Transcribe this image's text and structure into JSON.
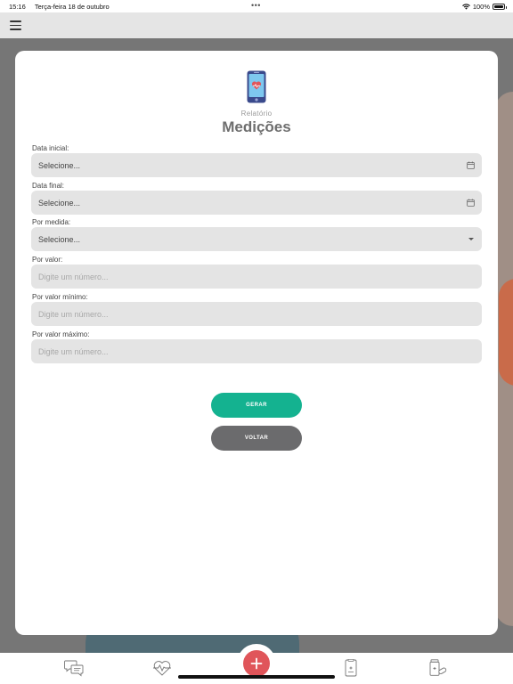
{
  "status_bar": {
    "time": "15:16",
    "date": "Terça-feira 18 de outubro",
    "dots": "•••",
    "battery": "100%"
  },
  "header": {
    "subtitle": "Relatório",
    "title": "Medições"
  },
  "form": {
    "data_inicial": {
      "label": "Data inicial:",
      "value": "Selecione..."
    },
    "data_final": {
      "label": "Data final:",
      "value": "Selecione..."
    },
    "por_medida": {
      "label": "Por medida:",
      "value": "Selecione..."
    },
    "por_valor": {
      "label": "Por valor:",
      "placeholder": "Digite um número..."
    },
    "por_valor_minimo": {
      "label": "Por valor mínimo:",
      "placeholder": "Digite um número..."
    },
    "por_valor_maximo": {
      "label": "Por valor máximo:",
      "placeholder": "Digite um número..."
    }
  },
  "buttons": {
    "gerar": "GERAR",
    "voltar": "VOLTAR"
  },
  "tab_bar": {
    "icons": [
      "chat-bubbles-icon",
      "heartbeat-icon",
      "plus-icon",
      "medical-tablet-icon",
      "medicine-bottle-icon"
    ]
  },
  "colors": {
    "primary": "#14b290",
    "secondary": "#6b6b6d",
    "fab": "#e0555a",
    "field_bg": "#e4e4e4",
    "title": "#6e6e6e"
  }
}
